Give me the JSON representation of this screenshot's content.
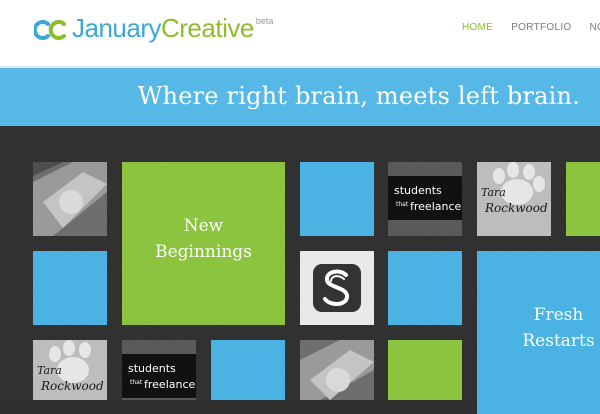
{
  "logo": {
    "january": "January",
    "creative": "Creative",
    "beta": "beta"
  },
  "nav": {
    "items": [
      "HOME",
      "PORTFOLIO",
      "NOTEB"
    ],
    "active": "HOME"
  },
  "banner": {
    "tagline": "Where right brain, meets left brain."
  },
  "tiles": {
    "new_beginnings": [
      "New",
      "Beginnings"
    ],
    "fresh_restarts": [
      "Fresh",
      "Restarts"
    ],
    "students_freelance": {
      "line1": "students",
      "line2": "that",
      "line3": "freelance"
    },
    "tara_rockwood": {
      "line1": "Tara",
      "line2": "Rockwood"
    }
  },
  "colors": {
    "blue": "#4bb3e3",
    "green": "#8cc43f",
    "background": "#2f2f2f",
    "banner": "#55b8e6"
  }
}
